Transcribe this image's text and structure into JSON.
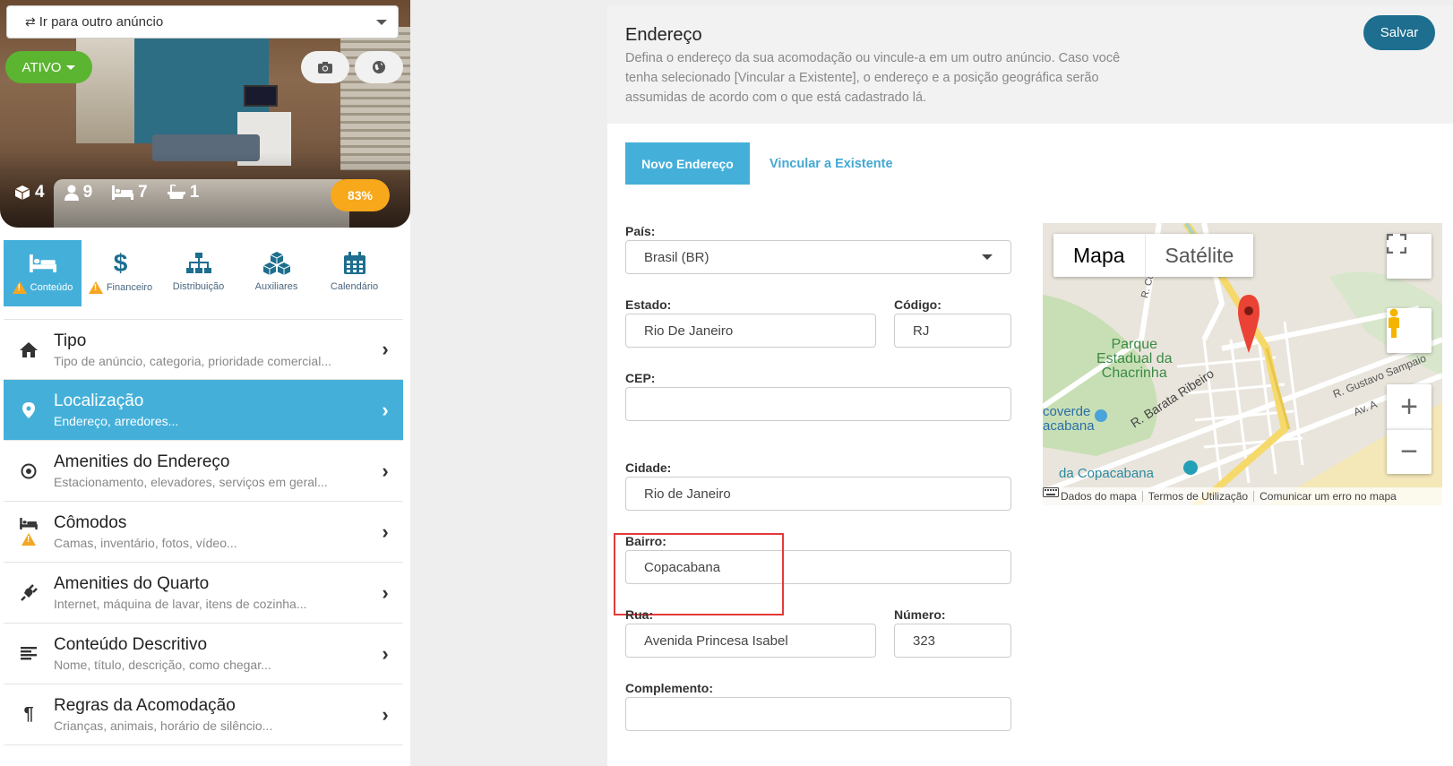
{
  "sidebar": {
    "goto_select": "Ir para outro anúncio",
    "status": "ATIVO",
    "stats": {
      "units": "4",
      "guests": "9",
      "beds": "7",
      "baths": "1"
    },
    "score": "83%",
    "tabs": [
      {
        "label": "Conteúdo",
        "icon": "bed-icon",
        "warning": true,
        "active": true
      },
      {
        "label": "Financeiro",
        "icon": "dollar-icon",
        "warning": true,
        "active": false
      },
      {
        "label": "Distribuição",
        "icon": "sitemap-icon",
        "warning": false,
        "active": false
      },
      {
        "label": "Auxiliares",
        "icon": "cubes-icon",
        "warning": false,
        "active": false
      },
      {
        "label": "Calendário",
        "icon": "calendar-icon",
        "warning": false,
        "active": false
      }
    ],
    "menu": [
      {
        "title": "Tipo",
        "subtitle": "Tipo de anúncio, categoria, prioridade comercial...",
        "icon": "home-icon"
      },
      {
        "title": "Localização",
        "subtitle": "Endereço, arredores...",
        "icon": "map-pin-icon"
      },
      {
        "title": "Amenities do Endereço",
        "subtitle": "Estacionamento, elevadores, serviços em geral...",
        "icon": "target-icon"
      },
      {
        "title": "Cômodos",
        "subtitle": "Camas, inventário, fotos, vídeo...",
        "icon": "bed-icon"
      },
      {
        "title": "Amenities do Quarto",
        "subtitle": "Internet, máquina de lavar, itens de cozinha...",
        "icon": "plug-icon"
      },
      {
        "title": "Conteúdo Descritivo",
        "subtitle": "Nome, título, descrição, como chegar...",
        "icon": "align-left-icon"
      },
      {
        "title": "Regras da Acomodação",
        "subtitle": "Crianças, animais, horário de silêncio...",
        "icon": "paragraph-icon"
      }
    ]
  },
  "main": {
    "title": "Endereço",
    "description": "Defina o endereço da sua acomodação ou vincule-a em um outro anúncio. Caso você tenha selecionado [Vincular a Existente], o endereço e a posição geográfica serão assumidas de acordo com o que está cadastrado lá.",
    "save_label": "Salvar",
    "tab_new": "Novo Endereço",
    "tab_link": "Vincular a Existente",
    "fields": {
      "country": {
        "label": "País:",
        "value": "Brasil (BR)"
      },
      "state": {
        "label": "Estado:",
        "value": "Rio De Janeiro"
      },
      "code": {
        "label": "Código:",
        "value": "RJ"
      },
      "zip": {
        "label": "CEP:",
        "value": ""
      },
      "city": {
        "label": "Cidade:",
        "value": "Rio de Janeiro"
      },
      "district": {
        "label": "Bairro:",
        "value": "Copacabana"
      },
      "street": {
        "label": "Rua:",
        "value": "Avenida Princesa Isabel"
      },
      "number": {
        "label": "Número:",
        "value": "323"
      },
      "complement": {
        "label": "Complemento:",
        "value": ""
      }
    }
  },
  "map": {
    "type_map": "Mapa",
    "type_satellite": "Satélite",
    "labels": {
      "park_line1": "Parque",
      "park_line2": "Estadual da",
      "park_line3": "Chacrinha",
      "street_coelho": "R. Coelho C",
      "street_barata": "R. Barata Ribeiro",
      "street_gustavo": "R. Gustavo Sampaio",
      "avenue": "Av. A",
      "metro_line1": "coverde",
      "metro_line2": "acabana",
      "beach": "da Copacabana"
    },
    "footer": {
      "data": "Dados do mapa",
      "terms": "Termos de Utilização",
      "report": "Comunicar um erro no mapa"
    },
    "colors": {
      "pin": "#ea4335",
      "park": "#c8dfb5",
      "road_highlight": "#f6d96b",
      "beach": "#f4e7b8"
    }
  },
  "colors": {
    "accent": "#44b0da",
    "status_green": "#5cb531",
    "score_orange": "#f7a81b",
    "save_button": "#1d6e8f",
    "warning": "#f5a623"
  }
}
